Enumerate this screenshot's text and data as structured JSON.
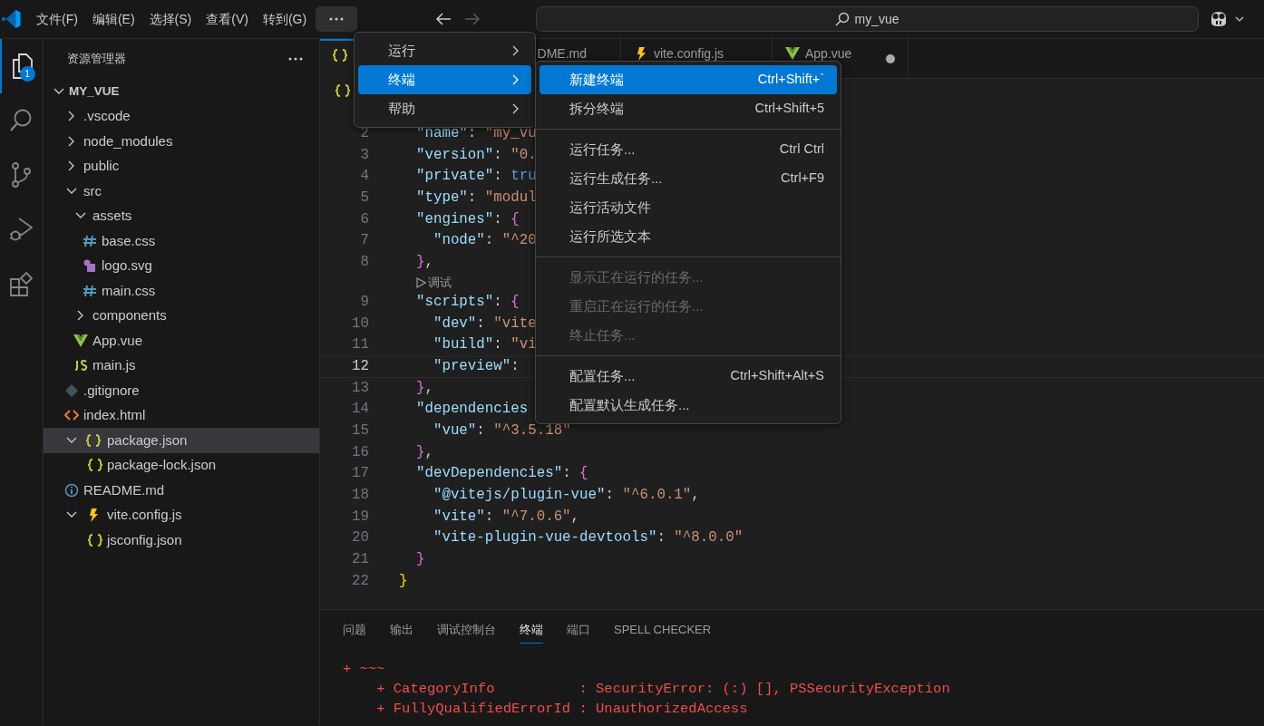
{
  "titlebar": {
    "menus": [
      "文件(F)",
      "编辑(E)",
      "选择(S)",
      "查看(V)",
      "转到(G)"
    ],
    "more_open": true,
    "back_enabled": true,
    "forward_enabled": false,
    "search": "my_vue"
  },
  "activity_bar": [
    {
      "kind": "explorer",
      "selected": true,
      "badge": "1"
    },
    {
      "kind": "search",
      "selected": false
    },
    {
      "kind": "scm",
      "selected": false
    },
    {
      "kind": "debug",
      "selected": false
    },
    {
      "kind": "extensions",
      "selected": false
    }
  ],
  "sidebar": {
    "title": "资源管理器",
    "root": "MY_VUE",
    "items": [
      {
        "label": ".vscode",
        "kind": "folder",
        "expanded": false,
        "selected": false
      },
      {
        "label": "node_modules",
        "kind": "folder",
        "expanded": false,
        "selected": false
      },
      {
        "label": "public",
        "kind": "folder",
        "expanded": false,
        "selected": false
      },
      {
        "label": "src",
        "kind": "folder",
        "expanded": true,
        "selected": false,
        "children": [
          {
            "label": "assets",
            "kind": "folder",
            "expanded": true,
            "selected": false,
            "children": [
              {
                "label": "base.css",
                "kind": "css",
                "selected": false
              },
              {
                "label": "logo.svg",
                "kind": "svg",
                "selected": false
              },
              {
                "label": "main.css",
                "kind": "css",
                "selected": false
              }
            ]
          },
          {
            "label": "components",
            "kind": "folder",
            "expanded": false,
            "selected": false
          },
          {
            "label": "App.vue",
            "kind": "vue",
            "selected": false
          },
          {
            "label": "main.js",
            "kind": "js",
            "selected": false
          }
        ]
      },
      {
        "label": ".gitignore",
        "kind": "git",
        "selected": false
      },
      {
        "label": "index.html",
        "kind": "html",
        "selected": false
      },
      {
        "label": "package.json",
        "kind": "json",
        "expanded": true,
        "selected": true,
        "children": [
          {
            "label": "package-lock.json",
            "kind": "json",
            "selected": false
          }
        ]
      },
      {
        "label": "README.md",
        "kind": "info",
        "selected": false
      },
      {
        "label": "vite.config.js",
        "kind": "vite",
        "expanded": true,
        "selected": false,
        "children": [
          {
            "label": "jsconfig.json",
            "kind": "json",
            "selected": false
          }
        ]
      }
    ]
  },
  "editor": {
    "tabs": [
      {
        "kind": "json",
        "selected": true,
        "modified": false
      },
      {
        "label": "DME.md",
        "selected": false,
        "modified": false
      },
      {
        "kind": "vite",
        "label": "vite.config.js",
        "selected": false,
        "modified": false
      },
      {
        "kind": "vue",
        "label": "App.vue",
        "selected": false,
        "modified": true
      }
    ],
    "lines": [
      {
        "kind": "code",
        "number": "2",
        "current": false,
        "tokens": [
          {
            "kind": "key",
            "text": "  \"name\""
          },
          {
            "kind": "punct",
            "text": ": "
          },
          {
            "kind": "string",
            "text": "\"my_vu"
          }
        ]
      },
      {
        "kind": "code",
        "number": "3",
        "current": false,
        "tokens": [
          {
            "kind": "key",
            "text": "  \"version\""
          },
          {
            "kind": "punct",
            "text": ": "
          },
          {
            "kind": "string",
            "text": "\"0."
          }
        ]
      },
      {
        "kind": "code",
        "number": "4",
        "current": false,
        "tokens": [
          {
            "kind": "key",
            "text": "  \"private\""
          },
          {
            "kind": "punct",
            "text": ": "
          },
          {
            "kind": "keyword",
            "text": "tru"
          }
        ]
      },
      {
        "kind": "code",
        "number": "5",
        "current": false,
        "tokens": [
          {
            "kind": "key",
            "text": "  \"type\""
          },
          {
            "kind": "punct",
            "text": ": "
          },
          {
            "kind": "string",
            "text": "\"modul"
          }
        ]
      },
      {
        "kind": "code",
        "number": "6",
        "current": false,
        "tokens": [
          {
            "kind": "key",
            "text": "  \"engines\""
          },
          {
            "kind": "punct",
            "text": ": "
          },
          {
            "kind": "brace2",
            "text": "{"
          }
        ]
      },
      {
        "kind": "code",
        "number": "7",
        "current": false,
        "tokens": [
          {
            "kind": "key",
            "text": "    \"node\""
          },
          {
            "kind": "punct",
            "text": ": "
          },
          {
            "kind": "string",
            "text": "\"^20"
          }
        ]
      },
      {
        "kind": "code",
        "number": "8",
        "current": false,
        "tokens": [
          {
            "kind": "brace2",
            "text": "  }"
          },
          {
            "kind": "punct",
            "text": ","
          }
        ]
      },
      {
        "kind": "codelens",
        "text": "调试"
      },
      {
        "kind": "code",
        "number": "9",
        "current": false,
        "tokens": [
          {
            "kind": "key",
            "text": "  \"scripts\""
          },
          {
            "kind": "punct",
            "text": ": "
          },
          {
            "kind": "brace2",
            "text": "{"
          }
        ]
      },
      {
        "kind": "code",
        "number": "10",
        "current": false,
        "tokens": [
          {
            "kind": "key",
            "text": "    \"dev\""
          },
          {
            "kind": "punct",
            "text": ": "
          },
          {
            "kind": "string",
            "text": "\"vite"
          }
        ]
      },
      {
        "kind": "code",
        "number": "11",
        "current": false,
        "tokens": [
          {
            "kind": "key",
            "text": "    \"build\""
          },
          {
            "kind": "punct",
            "text": ": "
          },
          {
            "kind": "string",
            "text": "\"vi"
          }
        ]
      },
      {
        "kind": "code",
        "number": "12",
        "current": true,
        "tokens": [
          {
            "kind": "key",
            "text": "    \"preview\""
          },
          {
            "kind": "punct",
            "text": ":"
          }
        ]
      },
      {
        "kind": "code",
        "number": "13",
        "current": false,
        "tokens": [
          {
            "kind": "brace2",
            "text": "  }"
          },
          {
            "kind": "punct",
            "text": ","
          }
        ]
      },
      {
        "kind": "code",
        "number": "14",
        "current": false,
        "tokens": [
          {
            "kind": "key",
            "text": "  \"dependencies"
          }
        ]
      },
      {
        "kind": "code",
        "number": "15",
        "current": false,
        "tokens": [
          {
            "kind": "key",
            "text": "    \"vue\""
          },
          {
            "kind": "punct",
            "text": ": "
          },
          {
            "kind": "string",
            "text": "\"^3.5.18\""
          }
        ]
      },
      {
        "kind": "code",
        "number": "16",
        "current": false,
        "tokens": [
          {
            "kind": "brace2",
            "text": "  }"
          },
          {
            "kind": "punct",
            "text": ","
          }
        ]
      },
      {
        "kind": "code",
        "number": "17",
        "current": false,
        "tokens": [
          {
            "kind": "key",
            "text": "  \"devDependencies\""
          },
          {
            "kind": "punct",
            "text": ": "
          },
          {
            "kind": "brace2",
            "text": "{"
          }
        ]
      },
      {
        "kind": "code",
        "number": "18",
        "current": false,
        "tokens": [
          {
            "kind": "key",
            "text": "    \"@vitejs/plugin-vue\""
          },
          {
            "kind": "punct",
            "text": ": "
          },
          {
            "kind": "string",
            "text": "\"^6.0.1\""
          },
          {
            "kind": "punct",
            "text": ","
          }
        ]
      },
      {
        "kind": "code",
        "number": "19",
        "current": false,
        "tokens": [
          {
            "kind": "key",
            "text": "    \"vite\""
          },
          {
            "kind": "punct",
            "text": ": "
          },
          {
            "kind": "string",
            "text": "\"^7.0.6\""
          },
          {
            "kind": "punct",
            "text": ","
          }
        ]
      },
      {
        "kind": "code",
        "number": "20",
        "current": false,
        "tokens": [
          {
            "kind": "key",
            "text": "    \"vite-plugin-vue-devtools\""
          },
          {
            "kind": "punct",
            "text": ": "
          },
          {
            "kind": "string",
            "text": "\"^8.0.0\""
          }
        ]
      },
      {
        "kind": "code",
        "number": "21",
        "current": false,
        "tokens": [
          {
            "kind": "brace2",
            "text": "  }"
          }
        ]
      },
      {
        "kind": "code",
        "number": "22",
        "current": false,
        "tokens": [
          {
            "kind": "brace1",
            "text": "}"
          }
        ]
      }
    ]
  },
  "panel": {
    "tabs": [
      {
        "label": "问题",
        "selected": false
      },
      {
        "label": "输出",
        "selected": false
      },
      {
        "label": "调试控制台",
        "selected": false
      },
      {
        "label": "终端",
        "selected": true
      },
      {
        "label": "端口",
        "selected": false
      },
      {
        "label": "SPELL CHECKER",
        "selected": false
      }
    ],
    "terminal": [
      "+ ~~~",
      "    + CategoryInfo          : SecurityError: (:) [], PSSecurityException",
      "    + FullyQualifiedErrorId : UnauthorizedAccess"
    ]
  },
  "menu": [
    {
      "label": "运行",
      "selected": false
    },
    {
      "label": "终端",
      "selected": true
    },
    {
      "label": "帮助",
      "selected": false
    }
  ],
  "submenu": [
    {
      "kind": "item",
      "label": "新建终端",
      "shortcut": "Ctrl+Shift+`",
      "selected": true,
      "disabled": false
    },
    {
      "kind": "item",
      "label": "拆分终端",
      "shortcut": "Ctrl+Shift+5",
      "selected": false,
      "disabled": false
    },
    {
      "kind": "separator"
    },
    {
      "kind": "item",
      "label": "运行任务...",
      "shortcut": "Ctrl Ctrl",
      "selected": false,
      "disabled": false
    },
    {
      "kind": "item",
      "label": "运行生成任务...",
      "shortcut": "Ctrl+F9",
      "selected": false,
      "disabled": false
    },
    {
      "kind": "item",
      "label": "运行活动文件",
      "selected": false,
      "disabled": false
    },
    {
      "kind": "item",
      "label": "运行所选文本",
      "selected": false,
      "disabled": false
    },
    {
      "kind": "separator"
    },
    {
      "kind": "item",
      "label": "显示正在运行的任务...",
      "selected": false,
      "disabled": true
    },
    {
      "kind": "item",
      "label": "重启正在运行的任务...",
      "selected": false,
      "disabled": true
    },
    {
      "kind": "item",
      "label": "终止任务...",
      "selected": false,
      "disabled": true
    },
    {
      "kind": "separator"
    },
    {
      "kind": "item",
      "label": "配置任务...",
      "shortcut": "Ctrl+Shift+Alt+S",
      "selected": false,
      "disabled": false
    },
    {
      "kind": "item",
      "label": "配置默认生成任务...",
      "selected": false,
      "disabled": false
    }
  ]
}
